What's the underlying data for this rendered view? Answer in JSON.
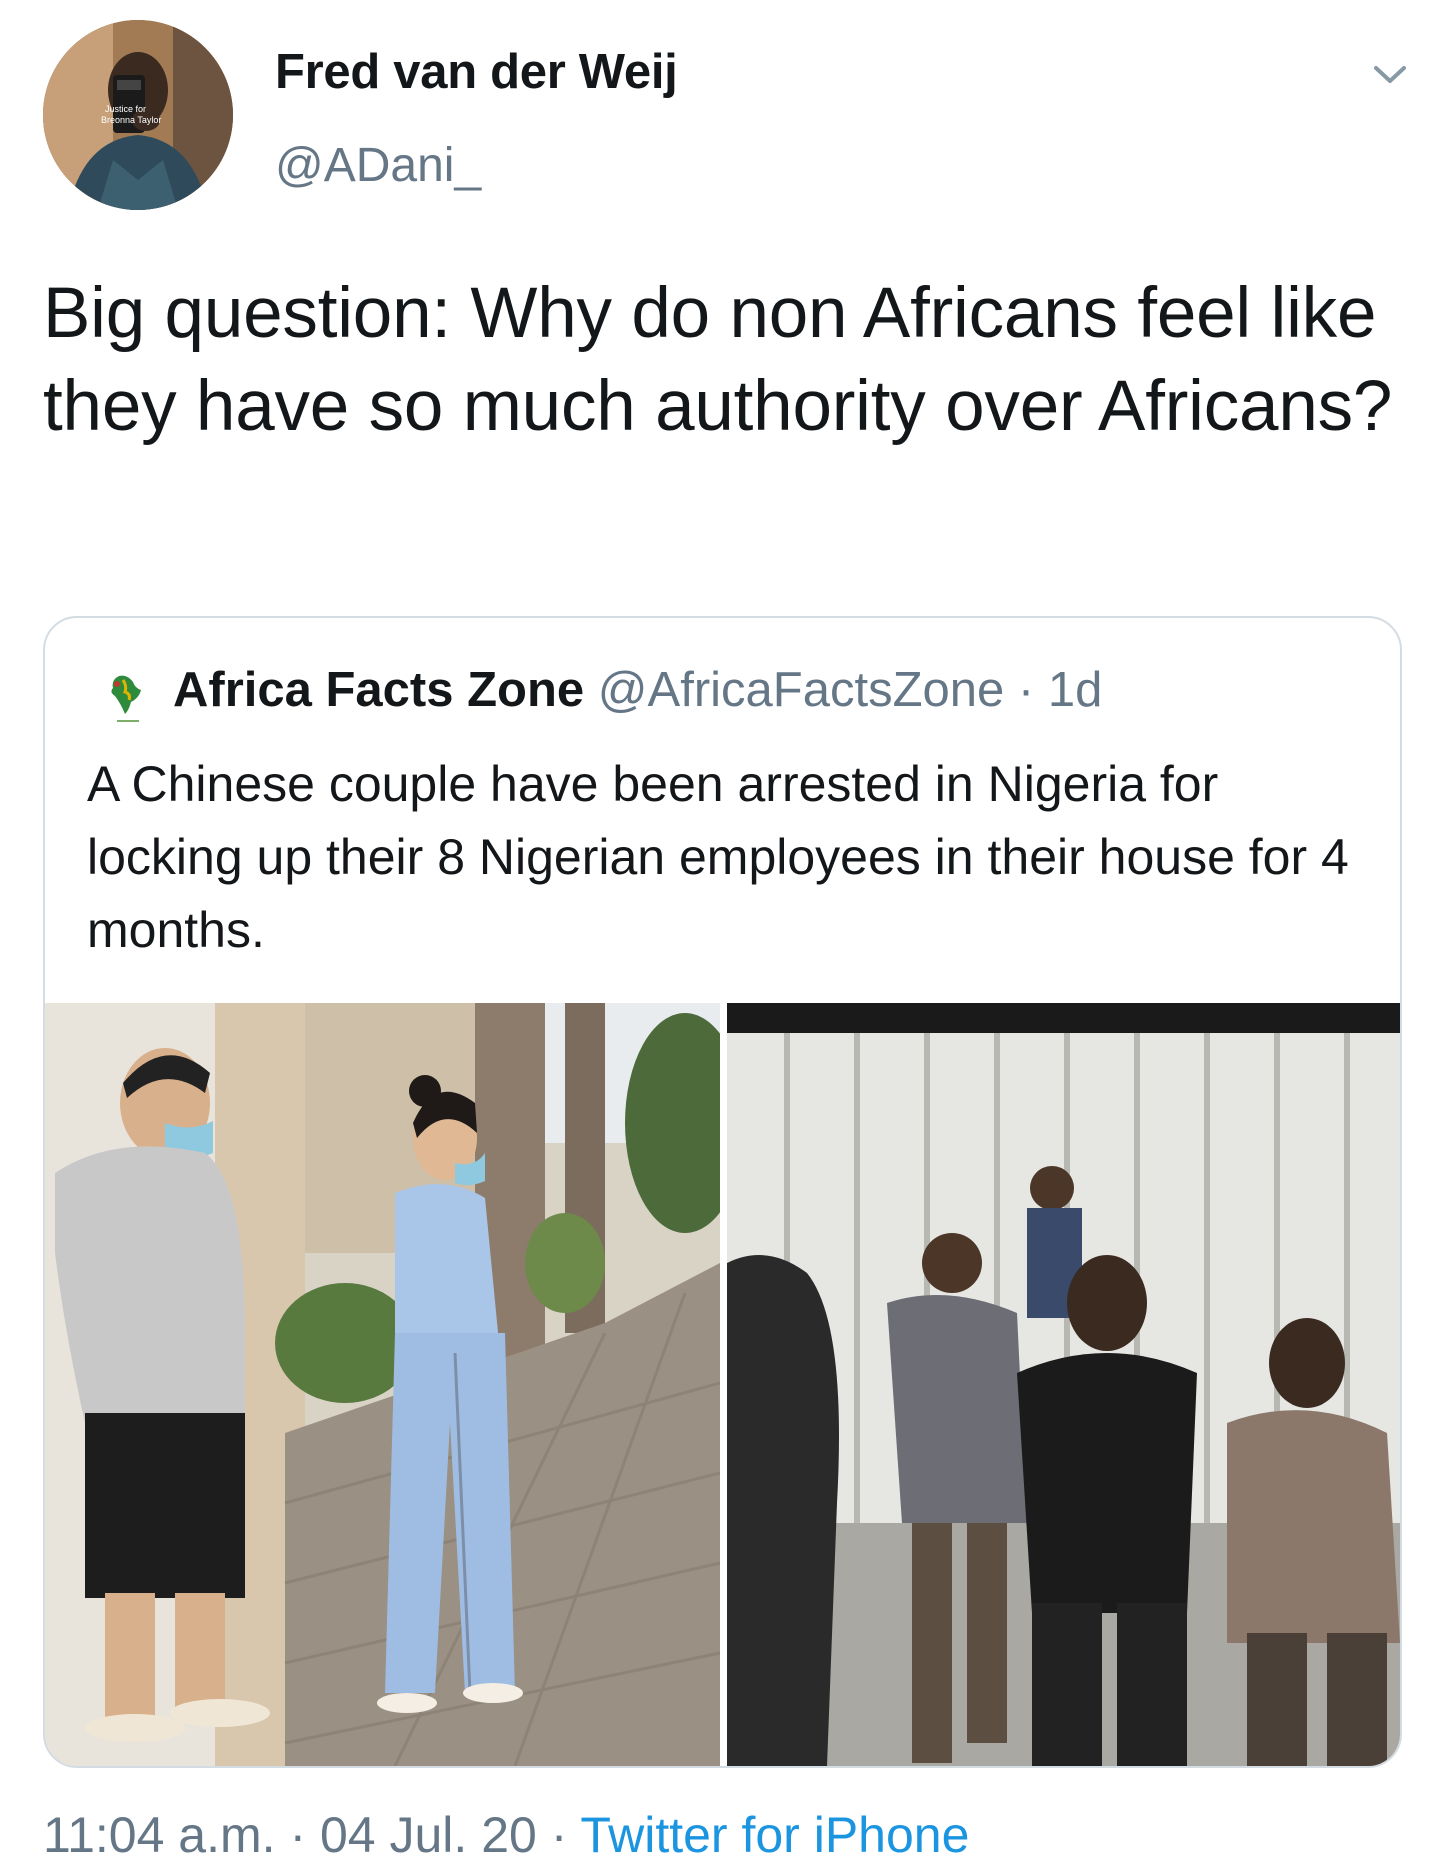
{
  "author": {
    "display_name": "Fred van der Weij",
    "handle": "@ADani_",
    "avatar_overlay_text": "Justice for Breonna Taylor"
  },
  "tweet": {
    "text": "Big question: Why do non Africans feel like they have so much authority over Africans?"
  },
  "quoted_tweet": {
    "display_name": "Africa Facts Zone",
    "handle": "@AfricaFactsZone",
    "separator": " · ",
    "age": "1d",
    "text": "A Chinese couple have been arrested in Nigeria for locking up their 8 Nigerian employees in their house for 4 months.",
    "media": [
      {
        "icon": "photo-couple-in-masks"
      },
      {
        "icon": "photo-group-of-men-at-gate"
      }
    ]
  },
  "footer": {
    "time": "11:04 a.m.",
    "separator": " · ",
    "date": "04 Jul. 20",
    "source": "Twitter for iPhone"
  },
  "colors": {
    "text_primary": "#14171a",
    "text_secondary": "#657786",
    "link": "#1b95e0",
    "card_border": "#d4dce3"
  }
}
